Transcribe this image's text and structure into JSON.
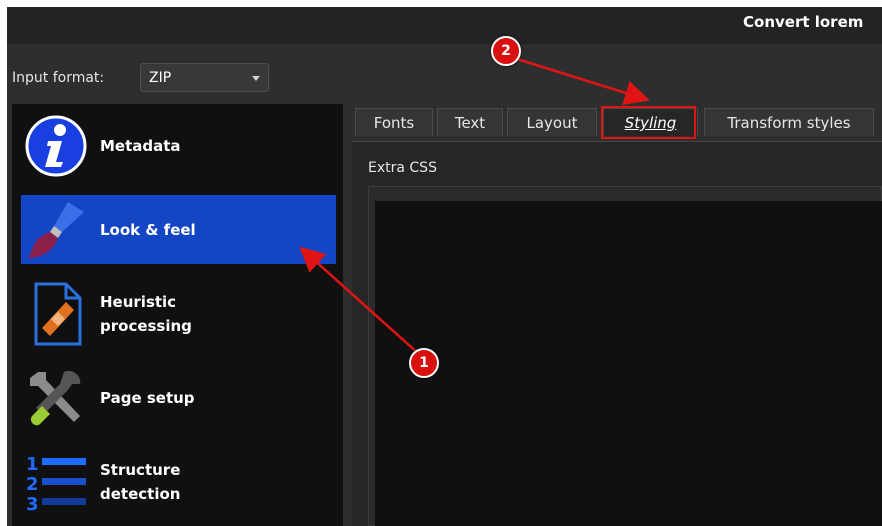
{
  "window": {
    "title": "Convert lorem"
  },
  "input_format": {
    "label": "Input format:",
    "value": "ZIP"
  },
  "sidebar": {
    "items": [
      {
        "label": "Metadata",
        "icon": "info-icon",
        "active": false
      },
      {
        "label": "Look & feel",
        "icon": "paintbrush-icon",
        "active": true
      },
      {
        "label": "Heuristic\nprocessing",
        "icon": "document-bandage-icon",
        "active": false
      },
      {
        "label": "Page setup",
        "icon": "tools-icon",
        "active": false
      },
      {
        "label": "Structure\ndetection",
        "icon": "numbered-list-icon",
        "active": false
      }
    ]
  },
  "tabs": [
    {
      "label": "Fonts",
      "active": false
    },
    {
      "label": "Text",
      "active": false
    },
    {
      "label": "Layout",
      "active": false
    },
    {
      "label": "Styling",
      "active": true
    },
    {
      "label": "Transform styles",
      "active": false
    }
  ],
  "styling": {
    "extra_css_label": "Extra CSS",
    "extra_css_value": ""
  },
  "annotations": {
    "badge1": "1",
    "badge2": "2",
    "arrow_color": "#e11414"
  },
  "colors": {
    "accent": "#1445c4",
    "sidebar_bg": "#101010",
    "window_bg": "#2e2e2e"
  }
}
